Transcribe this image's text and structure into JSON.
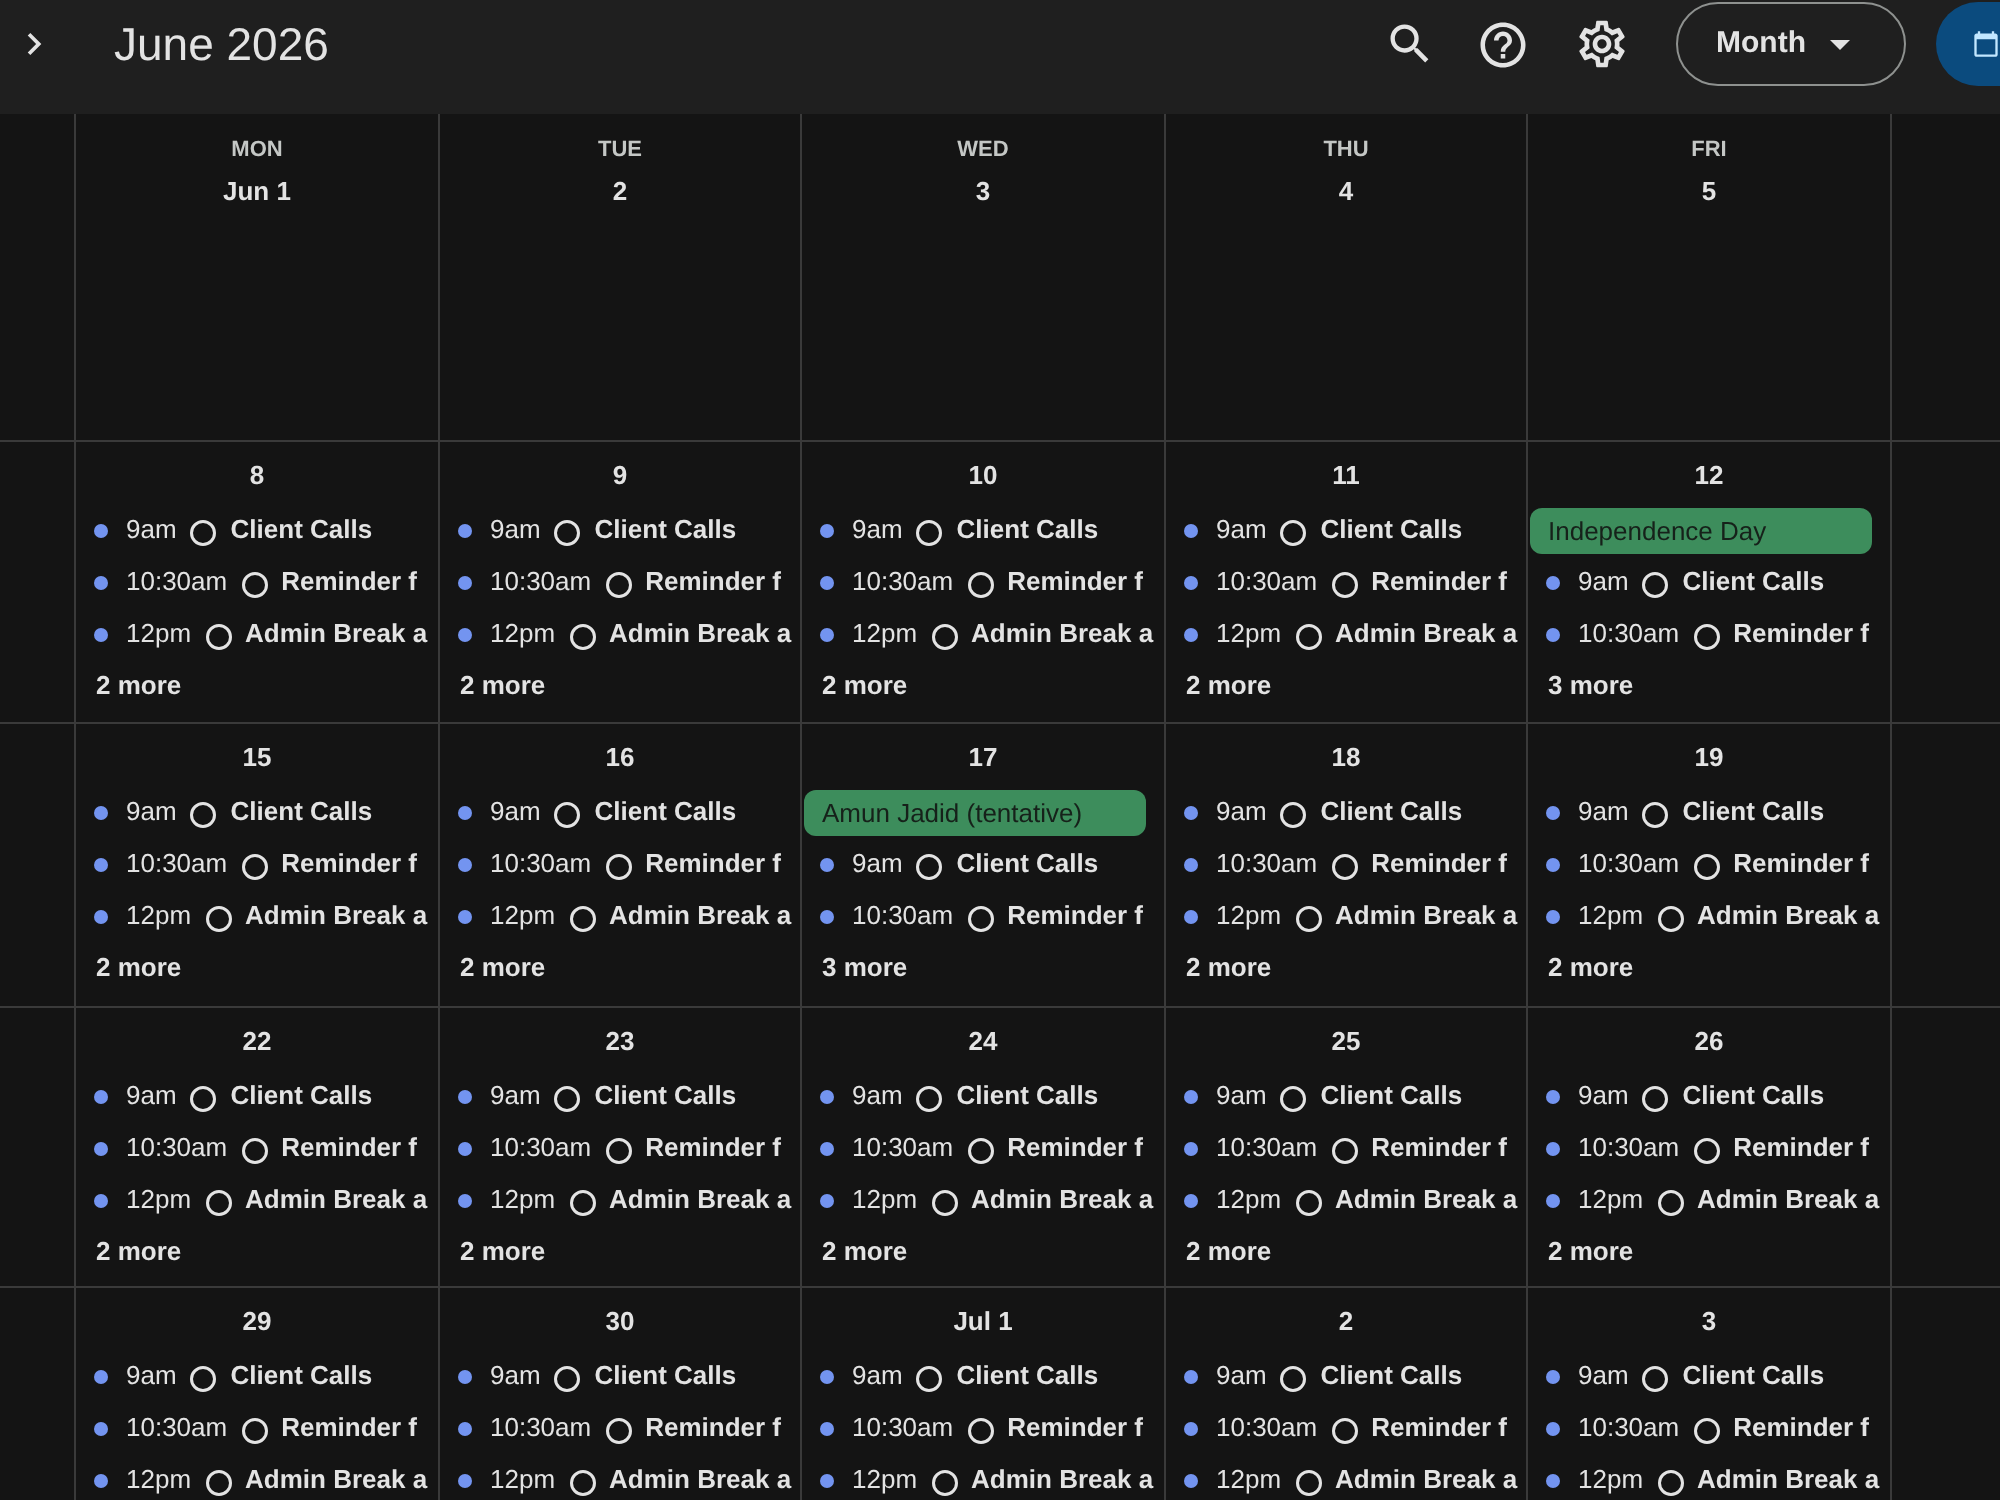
{
  "toolbar": {
    "title": "June 2026",
    "view": "Month"
  },
  "weekdays": [
    "MON",
    "TUE",
    "WED",
    "THU",
    "FRI"
  ],
  "weeks": [
    {
      "days": [
        {
          "date": "Jun 1"
        },
        {
          "date": "2"
        },
        {
          "date": "3"
        },
        {
          "date": "4"
        },
        {
          "date": "5"
        }
      ]
    },
    {
      "days": [
        {
          "date": "8",
          "events": [
            {
              "kind": "timed",
              "time": "9am",
              "title": "Client Calls"
            },
            {
              "kind": "timed",
              "time": "10:30am",
              "title": "Reminder f"
            },
            {
              "kind": "timed",
              "time": "12pm",
              "title": "Admin Break a"
            }
          ],
          "more": "2 more"
        },
        {
          "date": "9",
          "events": [
            {
              "kind": "timed",
              "time": "9am",
              "title": "Client Calls"
            },
            {
              "kind": "timed",
              "time": "10:30am",
              "title": "Reminder f"
            },
            {
              "kind": "timed",
              "time": "12pm",
              "title": "Admin Break a"
            }
          ],
          "more": "2 more"
        },
        {
          "date": "10",
          "events": [
            {
              "kind": "timed",
              "time": "9am",
              "title": "Client Calls"
            },
            {
              "kind": "timed",
              "time": "10:30am",
              "title": "Reminder f"
            },
            {
              "kind": "timed",
              "time": "12pm",
              "title": "Admin Break a"
            }
          ],
          "more": "2 more"
        },
        {
          "date": "11",
          "events": [
            {
              "kind": "timed",
              "time": "9am",
              "title": "Client Calls"
            },
            {
              "kind": "timed",
              "time": "10:30am",
              "title": "Reminder f"
            },
            {
              "kind": "timed",
              "time": "12pm",
              "title": "Admin Break a"
            }
          ],
          "more": "2 more"
        },
        {
          "date": "12",
          "events": [
            {
              "kind": "all_day",
              "title": "Independence Day"
            },
            {
              "kind": "timed",
              "time": "9am",
              "title": "Client Calls"
            },
            {
              "kind": "timed",
              "time": "10:30am",
              "title": "Reminder f"
            }
          ],
          "more": "3 more"
        }
      ]
    },
    {
      "days": [
        {
          "date": "15",
          "events": [
            {
              "kind": "timed",
              "time": "9am",
              "title": "Client Calls"
            },
            {
              "kind": "timed",
              "time": "10:30am",
              "title": "Reminder f"
            },
            {
              "kind": "timed",
              "time": "12pm",
              "title": "Admin Break a"
            }
          ],
          "more": "2 more"
        },
        {
          "date": "16",
          "events": [
            {
              "kind": "timed",
              "time": "9am",
              "title": "Client Calls"
            },
            {
              "kind": "timed",
              "time": "10:30am",
              "title": "Reminder f"
            },
            {
              "kind": "timed",
              "time": "12pm",
              "title": "Admin Break a"
            }
          ],
          "more": "2 more"
        },
        {
          "date": "17",
          "events": [
            {
              "kind": "all_day",
              "title": "Amun Jadid (tentative)"
            },
            {
              "kind": "timed",
              "time": "9am",
              "title": "Client Calls"
            },
            {
              "kind": "timed",
              "time": "10:30am",
              "title": "Reminder f"
            }
          ],
          "more": "3 more"
        },
        {
          "date": "18",
          "events": [
            {
              "kind": "timed",
              "time": "9am",
              "title": "Client Calls"
            },
            {
              "kind": "timed",
              "time": "10:30am",
              "title": "Reminder f"
            },
            {
              "kind": "timed",
              "time": "12pm",
              "title": "Admin Break a"
            }
          ],
          "more": "2 more"
        },
        {
          "date": "19",
          "events": [
            {
              "kind": "timed",
              "time": "9am",
              "title": "Client Calls"
            },
            {
              "kind": "timed",
              "time": "10:30am",
              "title": "Reminder f"
            },
            {
              "kind": "timed",
              "time": "12pm",
              "title": "Admin Break a"
            }
          ],
          "more": "2 more"
        }
      ]
    },
    {
      "days": [
        {
          "date": "22",
          "events": [
            {
              "kind": "timed",
              "time": "9am",
              "title": "Client Calls"
            },
            {
              "kind": "timed",
              "time": "10:30am",
              "title": "Reminder f"
            },
            {
              "kind": "timed",
              "time": "12pm",
              "title": "Admin Break a"
            }
          ],
          "more": "2 more"
        },
        {
          "date": "23",
          "events": [
            {
              "kind": "timed",
              "time": "9am",
              "title": "Client Calls"
            },
            {
              "kind": "timed",
              "time": "10:30am",
              "title": "Reminder f"
            },
            {
              "kind": "timed",
              "time": "12pm",
              "title": "Admin Break a"
            }
          ],
          "more": "2 more"
        },
        {
          "date": "24",
          "events": [
            {
              "kind": "timed",
              "time": "9am",
              "title": "Client Calls"
            },
            {
              "kind": "timed",
              "time": "10:30am",
              "title": "Reminder f"
            },
            {
              "kind": "timed",
              "time": "12pm",
              "title": "Admin Break a"
            }
          ],
          "more": "2 more"
        },
        {
          "date": "25",
          "events": [
            {
              "kind": "timed",
              "time": "9am",
              "title": "Client Calls"
            },
            {
              "kind": "timed",
              "time": "10:30am",
              "title": "Reminder f"
            },
            {
              "kind": "timed",
              "time": "12pm",
              "title": "Admin Break a"
            }
          ],
          "more": "2 more"
        },
        {
          "date": "26",
          "events": [
            {
              "kind": "timed",
              "time": "9am",
              "title": "Client Calls"
            },
            {
              "kind": "timed",
              "time": "10:30am",
              "title": "Reminder f"
            },
            {
              "kind": "timed",
              "time": "12pm",
              "title": "Admin Break a"
            }
          ],
          "more": "2 more"
        }
      ]
    },
    {
      "days": [
        {
          "date": "29",
          "events": [
            {
              "kind": "timed",
              "time": "9am",
              "title": "Client Calls"
            },
            {
              "kind": "timed",
              "time": "10:30am",
              "title": "Reminder f"
            },
            {
              "kind": "timed",
              "time": "12pm",
              "title": "Admin Break a"
            }
          ]
        },
        {
          "date": "30",
          "events": [
            {
              "kind": "timed",
              "time": "9am",
              "title": "Client Calls"
            },
            {
              "kind": "timed",
              "time": "10:30am",
              "title": "Reminder f"
            },
            {
              "kind": "timed",
              "time": "12pm",
              "title": "Admin Break a"
            }
          ]
        },
        {
          "date": "Jul 1",
          "events": [
            {
              "kind": "timed",
              "time": "9am",
              "title": "Client Calls"
            },
            {
              "kind": "timed",
              "time": "10:30am",
              "title": "Reminder f"
            },
            {
              "kind": "timed",
              "time": "12pm",
              "title": "Admin Break a"
            }
          ]
        },
        {
          "date": "2",
          "events": [
            {
              "kind": "timed",
              "time": "9am",
              "title": "Client Calls"
            },
            {
              "kind": "timed",
              "time": "10:30am",
              "title": "Reminder f"
            },
            {
              "kind": "timed",
              "time": "12pm",
              "title": "Admin Break a"
            }
          ]
        },
        {
          "date": "3",
          "events": [
            {
              "kind": "timed",
              "time": "9am",
              "title": "Client Calls"
            },
            {
              "kind": "timed",
              "time": "10:30am",
              "title": "Reminder f"
            },
            {
              "kind": "timed",
              "time": "12pm",
              "title": "Admin Break a"
            }
          ]
        }
      ]
    }
  ]
}
